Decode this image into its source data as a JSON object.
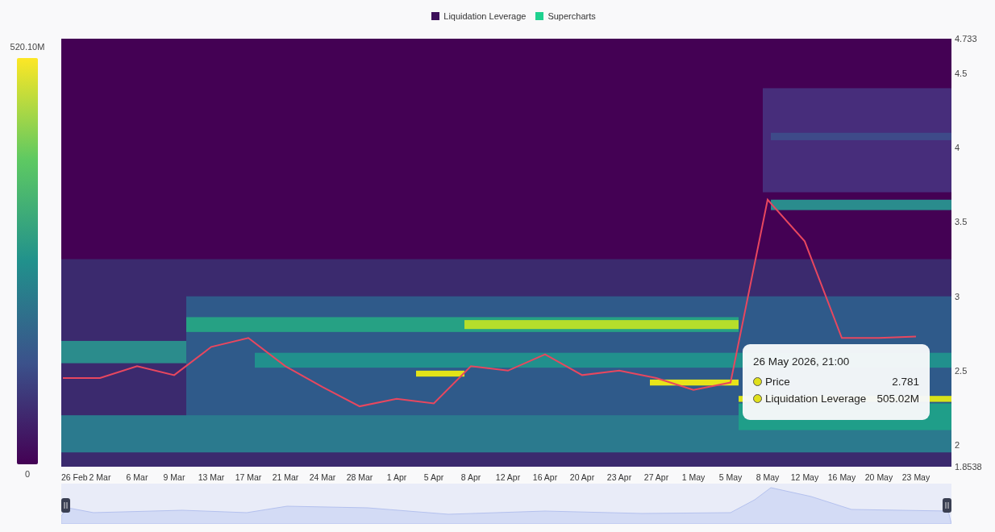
{
  "legend": [
    {
      "label": "Liquidation Leverage",
      "color": "#3d0f5a"
    },
    {
      "label": "Supercharts",
      "color": "#1fd18f"
    }
  ],
  "color_scale": {
    "max_label": "520.10M",
    "min_label": "0"
  },
  "chart": {
    "chart_data": {
      "type": "line",
      "categories": [
        "26 Feb",
        "2 Mar",
        "6 Mar",
        "9 Mar",
        "13 Mar",
        "17 Mar",
        "21 Mar",
        "24 Mar",
        "28 Mar",
        "1 Apr",
        "5 Apr",
        "8 Apr",
        "12 Apr",
        "16 Apr",
        "20 Apr",
        "23 Apr",
        "27 Apr",
        "1 May",
        "5 May",
        "8 May",
        "12 May",
        "16 May",
        "20 May",
        "23 May"
      ],
      "series": [
        {
          "color": "#e8475f",
          "values": [
            2.45,
            2.45,
            2.53,
            2.47,
            2.66,
            2.72,
            2.53,
            2.39,
            2.26,
            2.31,
            2.28,
            2.53,
            2.5,
            2.61,
            2.47,
            2.5,
            2.45,
            2.37,
            2.42,
            3.65,
            3.37,
            2.72,
            2.72,
            2.73
          ]
        }
      ],
      "ylim": [
        1.8538,
        4.733
      ],
      "yticks": [
        {
          "value": 1.8538,
          "label": "1.8538"
        },
        2,
        2.5,
        3,
        3.5,
        4,
        4.5,
        {
          "value": 4.733,
          "label": "4.733"
        }
      ]
    }
  },
  "tooltip": {
    "title": "26 May 2026, 21:00",
    "rows": [
      {
        "label": "Price",
        "value": "2.781"
      },
      {
        "label": "Liquidation Leverage",
        "value": "505.02M"
      }
    ]
  }
}
